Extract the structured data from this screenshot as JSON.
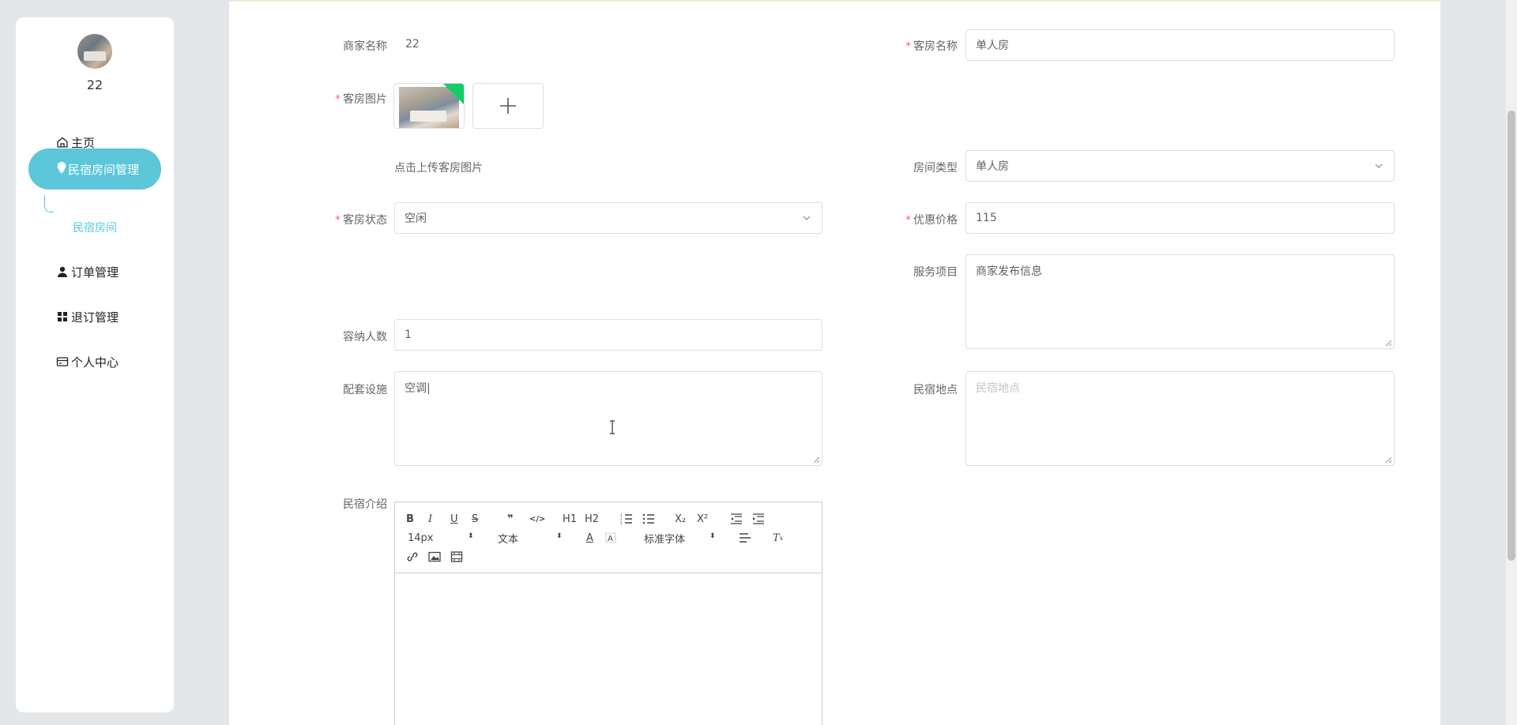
{
  "sidebar": {
    "username": "22",
    "menu": [
      {
        "label": "主页",
        "icon": "home-icon"
      },
      {
        "label": "民宿房间管理",
        "icon": "bulb-icon"
      },
      {
        "label": "订单管理",
        "icon": "user-icon"
      },
      {
        "label": "退订管理",
        "icon": "grid-icon"
      },
      {
        "label": "个人中心",
        "icon": "card-icon"
      }
    ],
    "submenu": {
      "label": "民宿房间"
    },
    "accent": "#5bc7d9"
  },
  "form": {
    "merchant_name": {
      "label": "商家名称",
      "value": "22"
    },
    "room_name": {
      "label": "客房名称",
      "value": "单人房"
    },
    "room_image": {
      "label": "客房图片",
      "hint": "点击上传客房图片"
    },
    "room_type": {
      "label": "房间类型",
      "value": "单人房"
    },
    "room_status": {
      "label": "客房状态",
      "value": "空闲"
    },
    "discount_price": {
      "label": "优惠价格",
      "value": "115"
    },
    "services": {
      "label": "服务项目",
      "value": "商家发布信息"
    },
    "capacity": {
      "label": "容纳人数",
      "value": "1"
    },
    "facilities": {
      "label": "配套设施",
      "value": "空调|"
    },
    "location": {
      "label": "民宿地点",
      "placeholder": "民宿地点"
    },
    "intro": {
      "label": "民宿介绍"
    }
  },
  "editor": {
    "font_size": "14px",
    "paragraph": "文本",
    "font_family": "标准字体",
    "buttons": [
      "B",
      "I",
      "U",
      "S",
      "❞",
      "</>",
      "H1",
      "H2",
      "ordered-list",
      "bullet-list",
      "X₂",
      "X²",
      "outdent",
      "indent"
    ]
  }
}
